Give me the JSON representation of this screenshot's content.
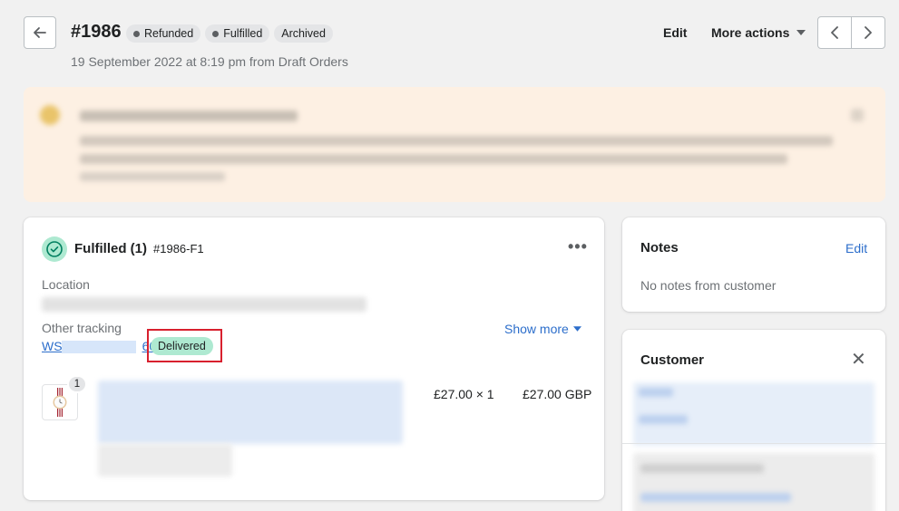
{
  "header": {
    "back_icon": "arrow-left-icon",
    "order_number": "#1986",
    "badges": [
      {
        "label": "Refunded",
        "dot": true
      },
      {
        "label": "Fulfilled",
        "dot": true
      },
      {
        "label": "Archived",
        "dot": false
      }
    ],
    "subtitle": "19 September 2022 at 8:19 pm from Draft Orders",
    "edit_label": "Edit",
    "more_actions_label": "More actions",
    "prev_icon": "chevron-left-icon",
    "next_icon": "chevron-right-icon"
  },
  "fulfillment": {
    "status_icon": "check-circle-icon",
    "title": "Fulfilled",
    "count": "(1)",
    "fulfillment_id": "#1986-F1",
    "location_label": "Location",
    "other_tracking_label": "Other tracking",
    "tracking_number_start": "WS",
    "tracking_number_end": "60",
    "tracking_status": "Delivered",
    "show_more_label": "Show more",
    "line_item": {
      "quantity_badge": "1",
      "unit_price": "£27.00 × 1",
      "total": "£27.00 GBP"
    }
  },
  "notes": {
    "title": "Notes",
    "edit_label": "Edit",
    "empty_text": "No notes from customer"
  },
  "customer": {
    "title": "Customer",
    "close_icon": "close-icon"
  },
  "colors": {
    "accent_link": "#2c6ecb",
    "success_badge": "#aee9d1",
    "highlight_border": "#d8202e",
    "banner_bg": "#fdf0e3"
  }
}
